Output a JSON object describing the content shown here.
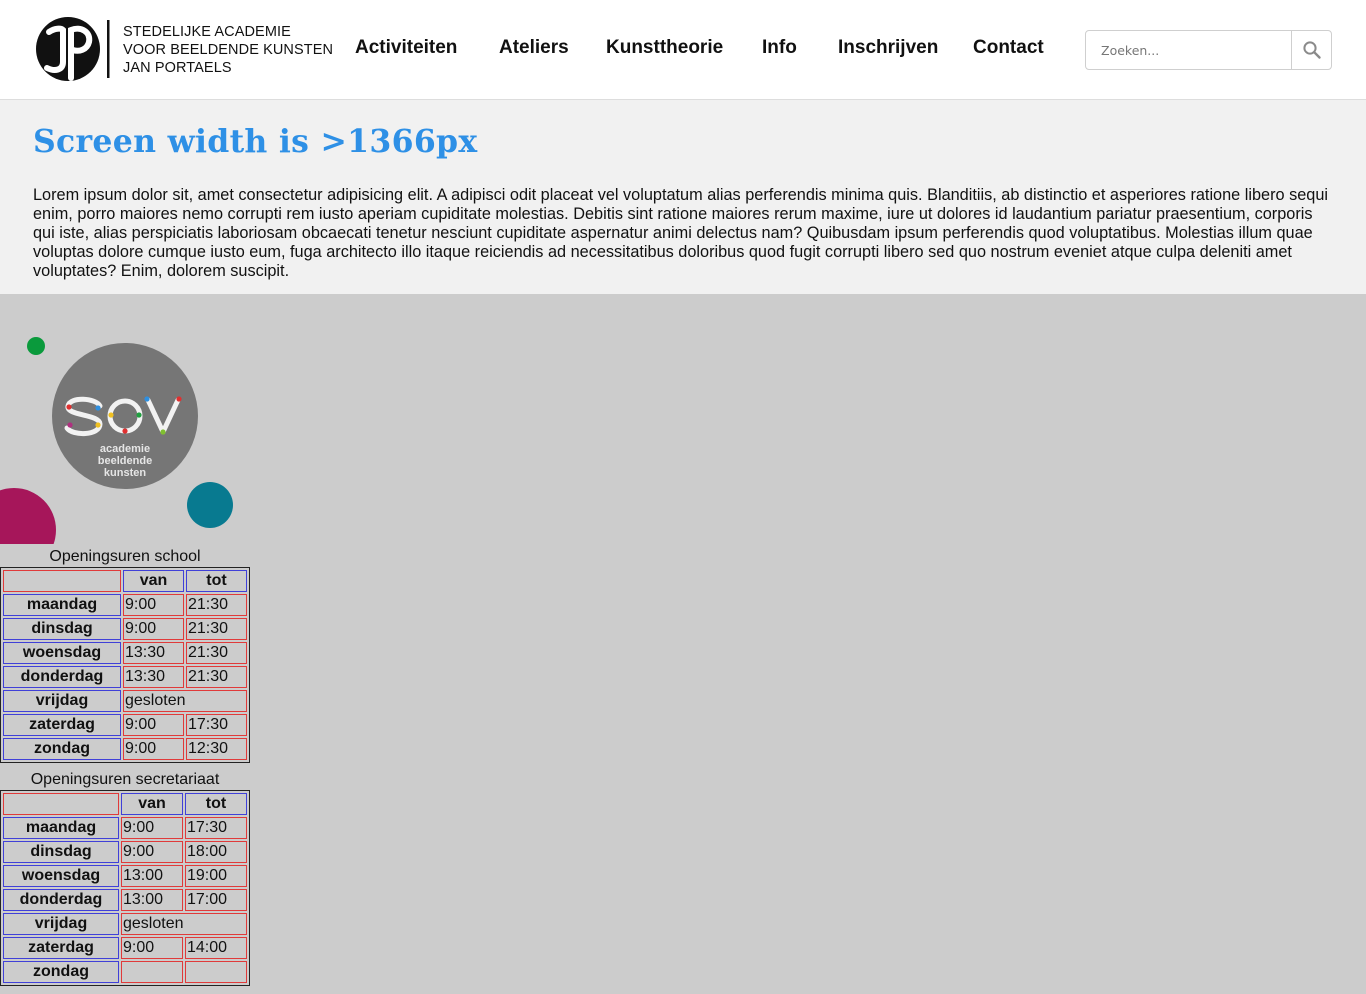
{
  "header": {
    "logo_mark": "JP",
    "logo_lines": [
      "STEDELIJKE ACADEMIE",
      "VOOR BEELDENDE KUNSTEN",
      "JAN PORTAELS"
    ],
    "nav": [
      "Activiteiten",
      "Ateliers",
      "Kunsttheorie",
      "Info",
      "Inschrijven",
      "Contact"
    ],
    "search_placeholder": "Zoeken...",
    "search_icon": "search-icon"
  },
  "intro": {
    "title": "Screen width is >1366px",
    "text": "Lorem ipsum dolor sit, amet consectetur adipisicing elit. A adipisci odit placeat vel voluptatum alias perferendis minima quis. Blanditiis, ab distinctio et asperiores ratione libero sequi enim, porro maiores nemo corrupti rem iusto aperiam cupiditate molestias. Debitis sint ratione maiores rerum maxime, iure ut dolores id laudantium pariatur praesentium, corporis qui iste, alias perspiciatis laboriosam obcaecati tenetur nesciunt cupiditate aspernatur animi delectus nam? Quibusdam ipsum perferendis quod voluptatibus. Molestias illum quae voluptas dolore cumque iusto eum, fuga architecto illo itaque reiciendis ad necessitatibus doloribus quod fugit corrupti libero sed quo nostrum eveniet atque culpa deleniti amet voluptates? Enim, dolorem suscipit."
  },
  "sov_logo": {
    "wordmark": "SOV",
    "sub_lines": [
      "academie",
      "beeldende",
      "kunsten"
    ],
    "colors": {
      "green": "#0a9a3c",
      "magenta": "#a6165a",
      "teal": "#087a90",
      "circle": "#767676"
    }
  },
  "school_hours": {
    "caption": "Openingsuren school",
    "col_from": "van",
    "col_to": "tot",
    "rows": [
      {
        "day": "maandag",
        "from": "9:00",
        "to": "21:30"
      },
      {
        "day": "dinsdag",
        "from": "9:00",
        "to": "21:30"
      },
      {
        "day": "woensdag",
        "from": "13:30",
        "to": "21:30"
      },
      {
        "day": "donderdag",
        "from": "13:30",
        "to": "21:30"
      },
      {
        "day": "vrijdag",
        "closed": "gesloten"
      },
      {
        "day": "zaterdag",
        "from": "9:00",
        "to": "17:30"
      },
      {
        "day": "zondag",
        "from": "9:00",
        "to": "12:30"
      }
    ]
  },
  "secretariat_hours": {
    "caption": "Openingsuren secretariaat",
    "col_from": "van",
    "col_to": "tot",
    "rows": [
      {
        "day": "maandag",
        "from": "9:00",
        "to": "17:30"
      },
      {
        "day": "dinsdag",
        "from": "9:00",
        "to": "18:00"
      },
      {
        "day": "woensdag",
        "from": "13:00",
        "to": "19:00"
      },
      {
        "day": "donderdag",
        "from": "13:00",
        "to": "17:00"
      },
      {
        "day": "vrijdag",
        "closed": "gesloten"
      },
      {
        "day": "zaterdag",
        "from": "9:00",
        "to": "14:00"
      },
      {
        "day": "zondag",
        "from": "",
        "to": ""
      }
    ]
  }
}
